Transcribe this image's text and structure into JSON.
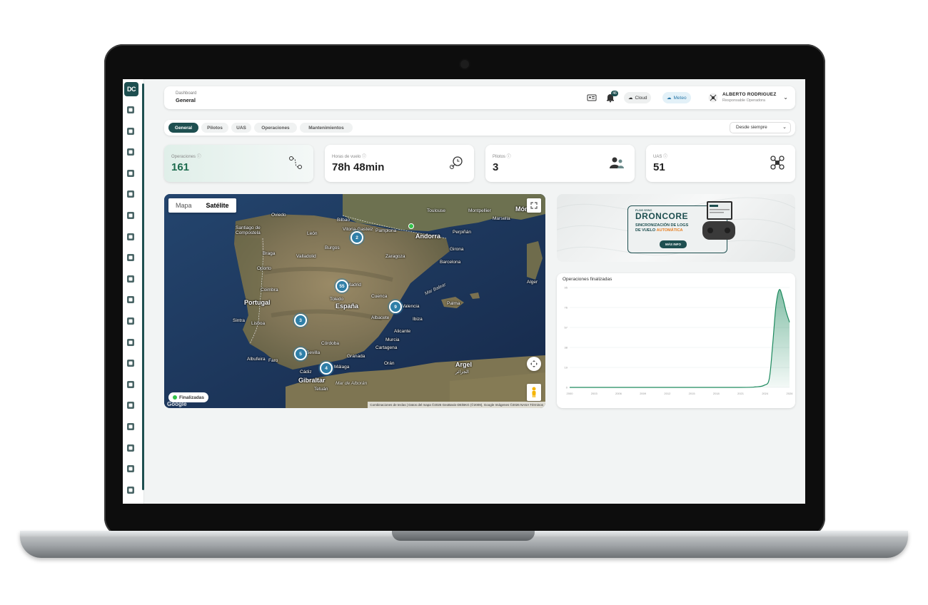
{
  "header": {
    "breadcrumb_top": "Dashboard",
    "breadcrumb_main": "General",
    "notifications_count": "46",
    "cloud_label": "Cloud",
    "meteo_label": "Meteo",
    "user_name": "ALBERTO RODRIGUEZ",
    "user_role": "Responsable Operadora"
  },
  "sidebar": {
    "logo_text": "DC",
    "icons": [
      "dashboard-icon",
      "checklist-icon",
      "radio-controller-icon",
      "pilots-icon",
      "drone-icon",
      "boot-icon",
      "battery-icon",
      "tools-icon",
      "network-icon",
      "route-icon",
      "calendar-icon",
      "book-icon",
      "tasks-icon",
      "document-icon",
      "link-icon",
      "graduation-cap-icon",
      "share-icon",
      "bell-icon",
      "report-icon"
    ]
  },
  "tabs": [
    "General",
    "Pilotos",
    "UAS",
    "Operaciones",
    "Mantenimientos"
  ],
  "active_tab": "General",
  "period_select": "Desde siempre",
  "kpis": [
    {
      "label": "Operaciones",
      "value": "161",
      "icon": "route-icon"
    },
    {
      "label": "Horas de vuelo",
      "value": "78h 48min",
      "icon": "drone-clock-icon"
    },
    {
      "label": "Pilotos",
      "value": "3",
      "icon": "pilots-icon"
    },
    {
      "label": "UAS",
      "value": "51",
      "icon": "drone-icon"
    }
  ],
  "map": {
    "type_options": [
      "Mapa",
      "Satélite"
    ],
    "selected_type": "Satélite",
    "legend_label": "Finalizadas",
    "clusters": [
      "2",
      "55",
      "9",
      "3",
      "5",
      "4"
    ],
    "cities": {
      "toulouse": "Toulouse",
      "montpellier": "Montpellier",
      "marsella": "Marsella",
      "mont": "Mónt",
      "bilbao": "Bilbao",
      "vitoria": "Vitoria-Gasteiz",
      "pamplona": "Pamplona",
      "andorra": "Andorra",
      "perpinan": "Perpiñán",
      "zaragoza": "Zaragoza",
      "girona": "Girona",
      "barcelona": "Barcelona",
      "santiago": "Santiago de Compostela",
      "oviedo": "Oviedo",
      "leon": "León",
      "burgos": "Burgos",
      "valladolid": "Valladolid",
      "braga": "Braga",
      "oporto": "Oporto",
      "coimbra": "Coimbra",
      "portugal": "Portugal",
      "madrid": "Madrid",
      "espana": "España",
      "valencia": "Valencia",
      "sintra": "Sintra",
      "lisboa": "Lisboa",
      "palma": "Palma",
      "ibiza": "Ibiza",
      "alicante": "Alicante",
      "murcia": "Murcia",
      "cordoba": "Córdoba",
      "sevilla": "Sevilla",
      "granada": "Granada",
      "malaga": "Málaga",
      "albufeira": "Albufeira",
      "faro": "Faro",
      "cadiz": "Cádiz",
      "gibraltar": "Gibraltar",
      "tetuan": "Tetuán",
      "argel": "Argel",
      "argel_ar": "الجزائر",
      "orán": "Orán",
      "mar_alboran": "Mar de Alborán",
      "mar_balear": "Mar Balear",
      "alger": "Alger",
      "toledo": "Toledo",
      "cuenca": "Cuenca",
      "albacete": "Albacete",
      "cartagena": "Cartagena"
    },
    "attribution": "Combinaciones de teclas  |  Datos del mapa ©2026 GeoBasis-DE/BKG (©2009), Google Imágenes ©2026 NASA   Términos",
    "google_logo": "Google"
  },
  "banner": {
    "subtitle": "FLOG SYNC",
    "brand": "DRONCORE",
    "line1": "SINCRONIZACIÓN DE LOGS",
    "line2_prefix": "DE VUELO",
    "line2_highlight": "AUTOMÁTICA",
    "cta": "MÁS INFO"
  },
  "colors": {
    "brand": "#1e4f50",
    "accent_green": "#1d8a5e",
    "cluster": "#2f7fa8",
    "meteo": "#2a78a8"
  },
  "chart_data": {
    "type": "area",
    "title": "Operaciones finalizadas",
    "xlabel": "",
    "ylabel": "",
    "x_tick_labels": [
      "2000",
      "2003",
      "2006",
      "2009",
      "2012",
      "2015",
      "2018",
      "2021",
      "2024",
      "2026"
    ],
    "y_tick_labels": [
      "0",
      "19",
      "38",
      "57",
      "76",
      "95"
    ],
    "ylim": [
      0,
      95
    ],
    "xlim": [
      2000,
      2026
    ],
    "series": [
      {
        "x": [
          2000,
          2010,
          2020,
          2022.0,
          2023.0,
          2023.6,
          2024.0,
          2024.4,
          2024.8,
          2025.2,
          2025.6,
          2026.0
        ],
        "values": [
          0,
          0,
          0,
          0.5,
          2,
          8,
          40,
          78,
          93,
          85,
          72,
          62
        ]
      }
    ],
    "grid": true
  }
}
